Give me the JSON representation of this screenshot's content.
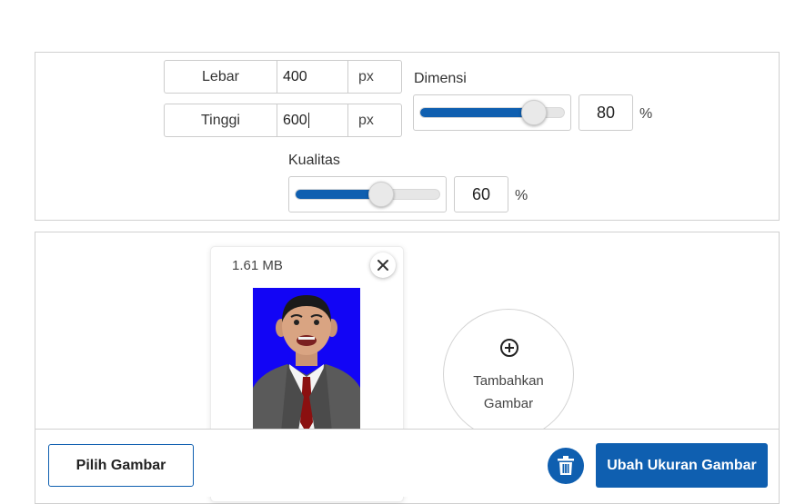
{
  "settings": {
    "width": {
      "label": "Lebar",
      "value": "400",
      "unit": "px"
    },
    "height": {
      "label": "Tinggi",
      "value": "600",
      "unit": "px"
    },
    "dimension": {
      "label": "Dimensi",
      "value": "80",
      "percent": 80,
      "unit": "%"
    },
    "quality": {
      "label": "Kualitas",
      "value": "60",
      "percent": 60,
      "unit": "%"
    }
  },
  "image_card": {
    "file_size": "1.61 MB",
    "close_icon": "close-icon"
  },
  "add_image": {
    "icon": "plus-circle-icon",
    "line1": "Tambahkan",
    "line2": "Gambar"
  },
  "footer": {
    "choose_label": "Pilih Gambar",
    "delete_icon": "trash-icon",
    "resize_label": "Ubah Ukuran Gambar"
  },
  "colors": {
    "accent": "#0f5fb0",
    "photo_background": "#1205f5"
  }
}
